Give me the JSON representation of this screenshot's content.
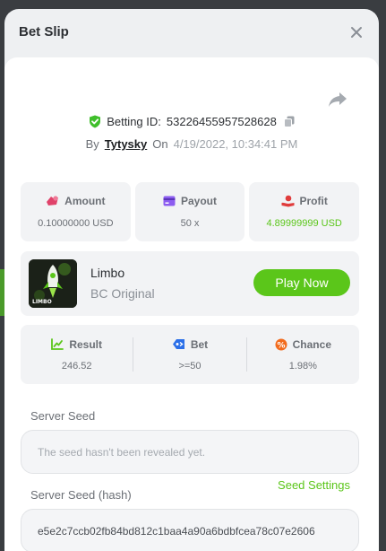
{
  "header": {
    "title": "Bet Slip"
  },
  "bet": {
    "id_label": "Betting ID:",
    "id": "53226455957528628",
    "by_label": "By",
    "user": "Tytysky",
    "on_label": "On",
    "date": "4/19/2022, 10:34:41 PM"
  },
  "stats": {
    "amount": {
      "label": "Amount",
      "value": "0.10000000 USD"
    },
    "payout": {
      "label": "Payout",
      "value": "50 x"
    },
    "profit": {
      "label": "Profit",
      "value": "4.89999999 USD"
    }
  },
  "game": {
    "name": "Limbo",
    "provider": "BC Original",
    "thumb_caption": "LIMBO",
    "play_label": "Play Now"
  },
  "result": {
    "result": {
      "label": "Result",
      "value": "246.52"
    },
    "bet": {
      "label": "Bet",
      "value": ">=50"
    },
    "chance": {
      "label": "Chance",
      "value": "1.98%"
    }
  },
  "server_seed": {
    "label": "Server Seed",
    "value": "The seed hasn't been revealed yet."
  },
  "server_seed_hash": {
    "label": "Server Seed (hash)",
    "settings_label": "Seed Settings",
    "value": "e5e2c7ccb02fb84bd812c1baa4a90a6bdbfcea78c07e2606"
  },
  "colors": {
    "accent_green": "#5bc61a",
    "modal_bg": "#eef0f2",
    "card_bg": "#f2f3f5"
  },
  "icons": [
    "close-icon",
    "share-icon",
    "shield-check-icon",
    "copy-icon",
    "amount-icon",
    "payout-icon",
    "profit-icon",
    "result-icon",
    "bet-tag-icon",
    "chance-icon"
  ]
}
